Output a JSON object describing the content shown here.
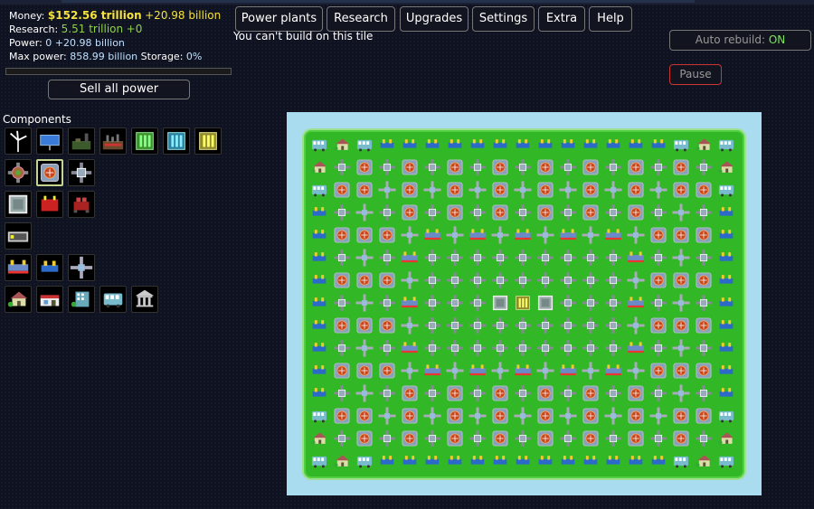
{
  "stats": {
    "money_label": "Money:",
    "money_value": "$152.56 trillion",
    "money_delta": "+20.98 billion",
    "research_label": "Research:",
    "research_value": "5.51 trillion",
    "research_delta": "+0",
    "power_label": "Power:",
    "power_value": "0",
    "power_delta": "+20.98 billion",
    "maxpower_label": "Max power:",
    "maxpower_value": "858.99 billion",
    "storage_label": "Storage:",
    "storage_value": "0%",
    "storage_fraction": 0
  },
  "sell_label": "Sell all power",
  "tabs": [
    "Power plants",
    "Research",
    "Upgrades",
    "Settings",
    "Extra",
    "Help"
  ],
  "message": "You can't build on this tile",
  "auto_rebuild_label": "Auto rebuild:",
  "auto_rebuild_state": "ON",
  "pause_label": "Pause",
  "components_title": "Components",
  "components": [
    [
      "wind-turbine-icon",
      "solar-panel-icon",
      "coal-plant-icon",
      "factory-icon",
      "green-cell-icon",
      "cyan-cell-icon",
      "yellow-cell-icon"
    ],
    [
      "gear-plate-icon",
      "reactor-cell-icon",
      "pipe-cross-icon"
    ],
    [
      "gray-block-icon",
      "red-generator-icon",
      "red-bot-icon"
    ],
    [
      "battery-icon"
    ],
    [
      "heat-exchanger-icon",
      "heat-exchanger-small-icon",
      "crosspipe-icon"
    ],
    [
      "house-icon",
      "shop-icon",
      "office-icon",
      "bus-icon",
      "bank-icon"
    ]
  ],
  "colors": {
    "background": "#0f1220",
    "money": "#f5e23b",
    "research": "#8fd14a",
    "on": "#7ee45a",
    "pause_border": "#cc3333",
    "water": "#a8dcee",
    "grass": "#32b826"
  }
}
